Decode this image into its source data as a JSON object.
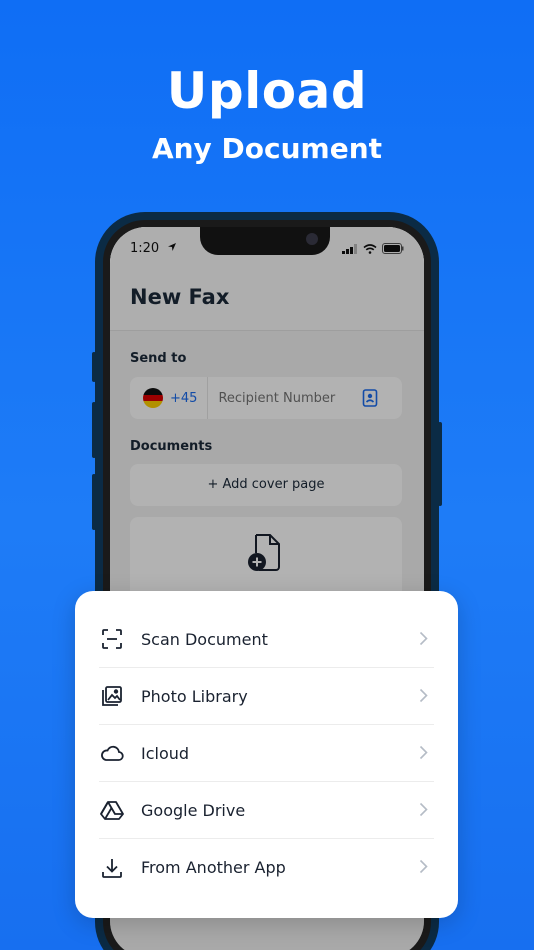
{
  "hero": {
    "title": "Upload",
    "subtitle": "Any Document"
  },
  "status_bar": {
    "time": "1:20"
  },
  "screen": {
    "title": "New Fax",
    "send_to_label": "Send to",
    "country_code": "+45",
    "recipient_placeholder": "Recipient Number",
    "documents_label": "Documents",
    "cover_page_label": "+ Add cover page"
  },
  "sheet": {
    "items": [
      {
        "label": "Scan Document",
        "icon": "scan-icon"
      },
      {
        "label": "Photo Library",
        "icon": "photo-library-icon"
      },
      {
        "label": "Icloud",
        "icon": "cloud-icon"
      },
      {
        "label": "Google Drive",
        "icon": "google-drive-icon"
      },
      {
        "label": "From Another App",
        "icon": "download-icon"
      }
    ]
  },
  "colors": {
    "background": "#1577f5",
    "accent": "#1a6cf0",
    "text_dark": "#1a2230"
  }
}
